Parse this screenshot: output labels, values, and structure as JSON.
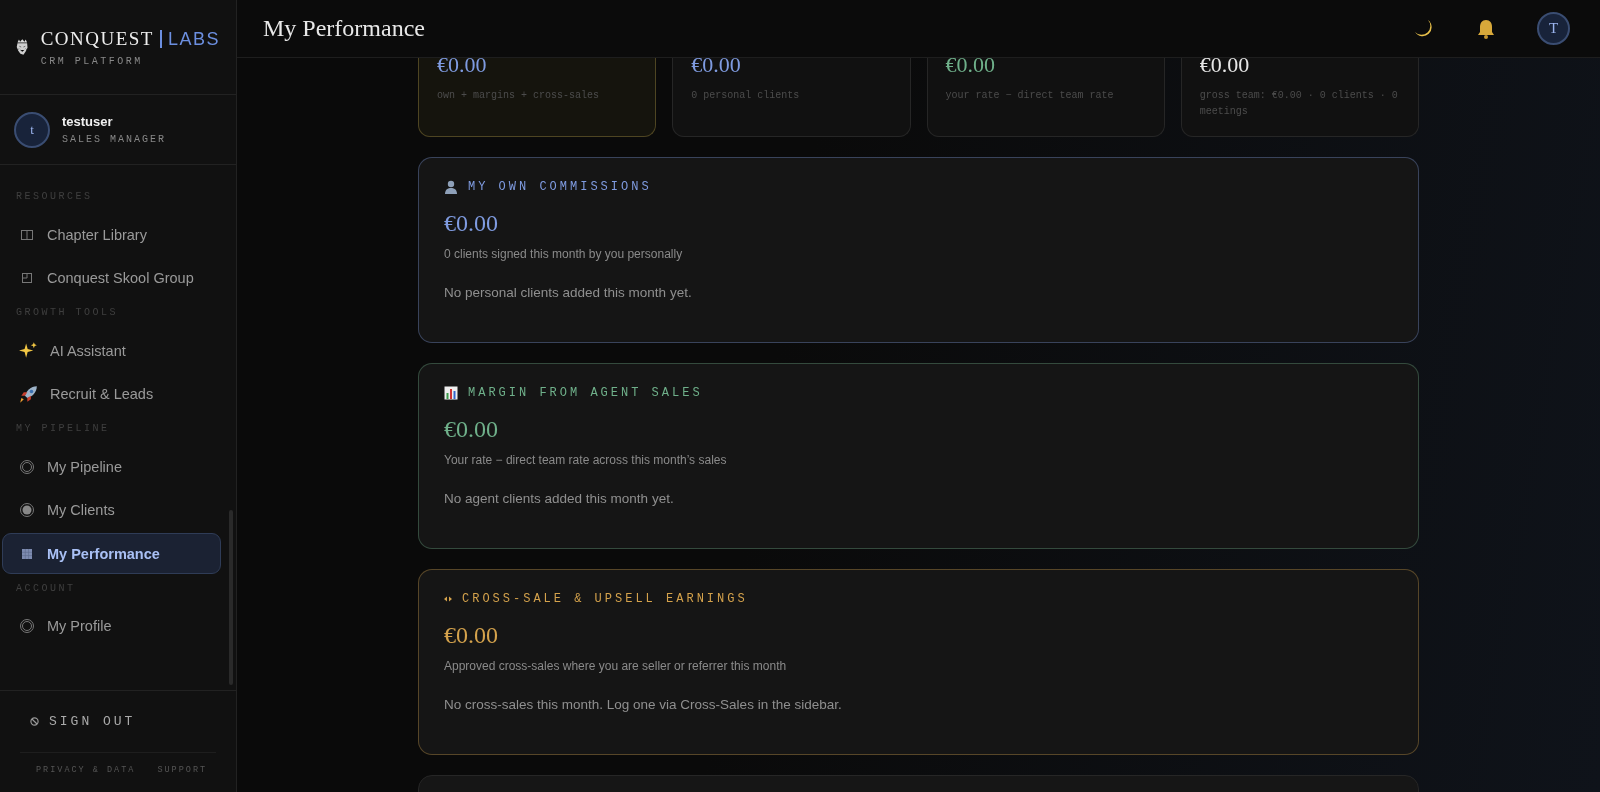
{
  "brand": {
    "name": "CONQUEST",
    "suffix": "LABS",
    "tagline": "CRM PLATFORM"
  },
  "user": {
    "initial": "t",
    "name": "testuser",
    "role": "SALES MANAGER"
  },
  "sidebar": {
    "groups": [
      {
        "label": "RESOURCES",
        "items": [
          {
            "label": "Chapter Library",
            "kind": "book",
            "selected": false
          },
          {
            "label": "Conquest Skool Group",
            "kind": "square",
            "selected": false
          }
        ]
      },
      {
        "label": "GROWTH TOOLS",
        "items": [
          {
            "label": "AI Assistant",
            "kind": "sparkles",
            "selected": false
          },
          {
            "label": "Recruit & Leads",
            "kind": "rocket",
            "selected": false
          }
        ]
      },
      {
        "label": "MY PIPELINE",
        "items": [
          {
            "label": "My Pipeline",
            "kind": "ring",
            "selected": false
          },
          {
            "label": "My Clients",
            "kind": "dot",
            "selected": false
          },
          {
            "label": "My Performance",
            "kind": "grid",
            "selected": true
          }
        ]
      },
      {
        "label": "ACCOUNT",
        "items": [
          {
            "label": "My Profile",
            "kind": "ring",
            "selected": false
          }
        ]
      }
    ],
    "sign_out": "SIGN OUT",
    "footer_links": [
      "PRIVACY & DATA",
      "SUPPORT"
    ]
  },
  "header": {
    "title": "My Performance",
    "avatar_initial": "T"
  },
  "summary_cards": [
    {
      "amount": "€0.00",
      "note": "own + margins + cross-sales",
      "color": "#7f9be0",
      "highlighted": true
    },
    {
      "amount": "€0.00",
      "note": "0 personal clients",
      "color": "#7f9be0",
      "highlighted": false
    },
    {
      "amount": "€0.00",
      "note": "your rate − direct team rate",
      "color": "#6fb08a",
      "highlighted": false
    },
    {
      "amount": "€0.00",
      "note": "gross team: €0.00 · 0 clients · 0 meetings",
      "color": "#e6e6e6",
      "highlighted": false
    }
  ],
  "sections": [
    {
      "kind": "person",
      "title": "MY OWN COMMISSIONS",
      "amount": "€0.00",
      "subtitle": "0 clients signed this month by you personally",
      "empty_text": "No personal clients added this month yet.",
      "color": "#7f9be0"
    },
    {
      "kind": "chart",
      "title": "MARGIN FROM AGENT SALES",
      "amount": "€0.00",
      "subtitle": "Your rate − direct team rate across this month’s sales",
      "empty_text": "No agent clients added this month yet.",
      "color": "#6fb08a"
    },
    {
      "kind": "arrows",
      "title": "CROSS-SALE & UPSELL EARNINGS",
      "amount": "€0.00",
      "subtitle": "Approved cross-sales where you are seller or referrer this month",
      "empty_text": "No cross-sales this month. Log one via Cross-Sales in the sidebar.",
      "color": "#d4a24c"
    }
  ]
}
